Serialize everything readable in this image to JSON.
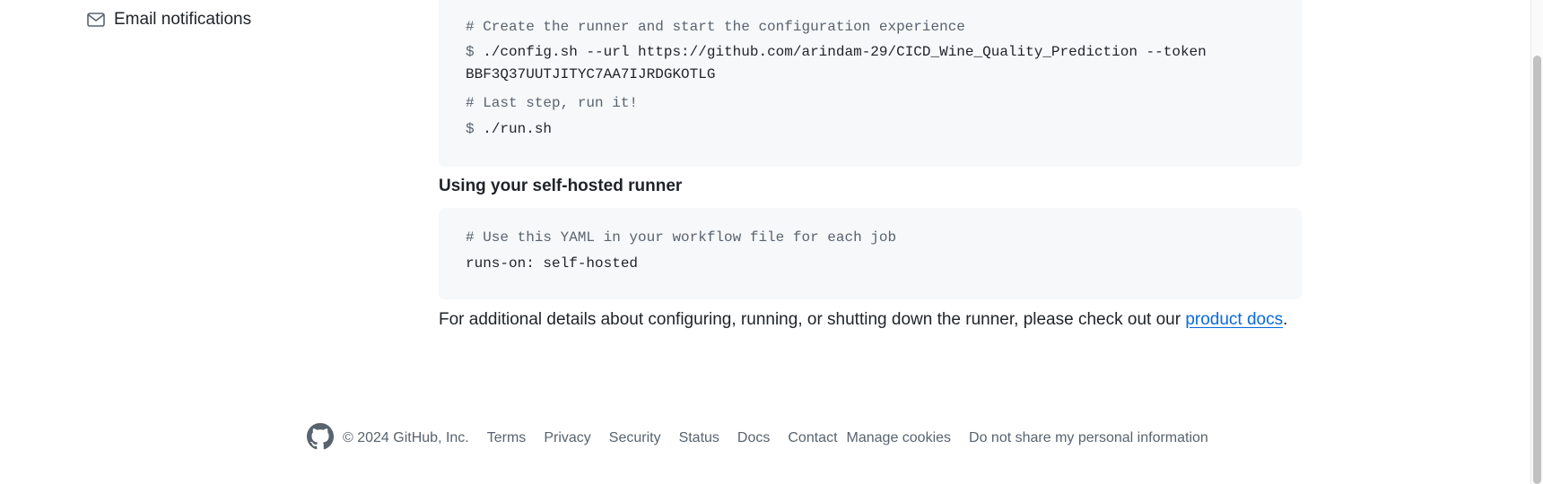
{
  "sidebar": {
    "email_notifications": {
      "label": "Email notifications",
      "icon": "mail-icon"
    }
  },
  "configure_block": {
    "comment_create": "# Create the runner and start the configuration experience",
    "config_prompt": "$",
    "config_command": "./config.sh --url https://github.com/arindam-29/CICD_Wine_Quality_Prediction --token",
    "config_token": "BBF3Q37UUTJITYC7AA7IJRDGKOTLG",
    "comment_run": "# Last step, run it!",
    "run_prompt": "$",
    "run_command": "./run.sh"
  },
  "usage": {
    "heading": "Using your self-hosted runner",
    "comment": "# Use this YAML in your workflow file for each job",
    "yaml": "runs-on: self-hosted"
  },
  "note": {
    "text": "For additional details about configuring, running, or shutting down the runner, please check out our ",
    "link": "product docs",
    "end": "."
  },
  "footer": {
    "logo_icon": "github-logo-icon",
    "copyright": "© 2024 GitHub, Inc.",
    "links": [
      "Terms",
      "Privacy",
      "Security",
      "Status",
      "Docs",
      "Contact",
      "Manage cookies",
      "Do not share my personal information"
    ]
  },
  "colors": {
    "link": "#0969da",
    "code_bg": "#f6f8fa",
    "muted": "#59636e",
    "text": "#1f2328"
  }
}
